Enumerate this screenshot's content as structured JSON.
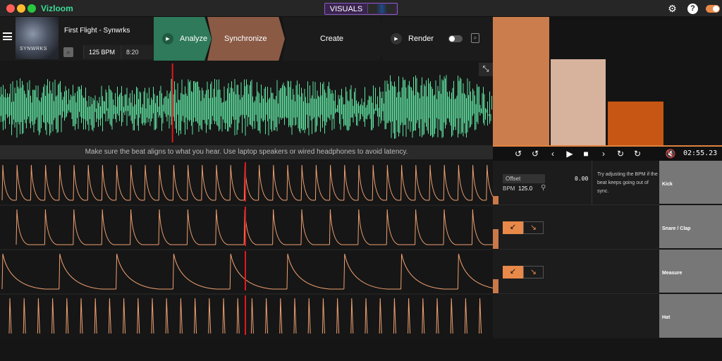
{
  "app": {
    "name": "Vizloom",
    "visuals_label": "VISUALS",
    "icons": {
      "settings": "gear-icon",
      "help": "question-icon",
      "help_glyph": "?",
      "theme": "toggle-icon"
    }
  },
  "track": {
    "title": "First Flight - Synwrks",
    "bpm": "125 BPM",
    "duration": "8:20",
    "art_text": "SYNWRKS"
  },
  "steps": [
    {
      "label": "Analyze",
      "color": "#2e7a5a"
    },
    {
      "label": "Synchronize",
      "color": "#8a5a45"
    },
    {
      "label": "Create"
    },
    {
      "label": "Render"
    }
  ],
  "render": {
    "toggle_on": false
  },
  "waveform": {
    "color": "#5fe3a1",
    "playhead_color": "#e0171f",
    "playhead_fraction": 0.35
  },
  "preview": {
    "bars": [
      {
        "level": 1.0,
        "color": "#cc7d4d"
      },
      {
        "level": 0.67,
        "color": "#d7b29d"
      },
      {
        "level": 0.34,
        "color": "#c75614"
      }
    ]
  },
  "info_message": "Make sure the beat aligns to what you hear. Use laptop speakers or wired headphones to avoid latency.",
  "transport": {
    "time": "02:55.23",
    "icons": [
      "rewind-15-icon",
      "rewind-icon",
      "prev-icon",
      "play-icon",
      "stop-icon",
      "next-icon",
      "forward-icon",
      "forward-15-icon",
      "mute-icon"
    ]
  },
  "sync": {
    "offset_label": "Offset",
    "offset_value": "0.00",
    "bpm_label": "BPM",
    "bpm_value": "125.0",
    "tip": "Try adjusting the BPM if the beat keeps going out of sync."
  },
  "lanes": [
    {
      "name": "Kick"
    },
    {
      "name": "Snare / Clap"
    },
    {
      "name": "Measure"
    },
    {
      "name": "Hat"
    }
  ],
  "lane_color": "#f0a070"
}
